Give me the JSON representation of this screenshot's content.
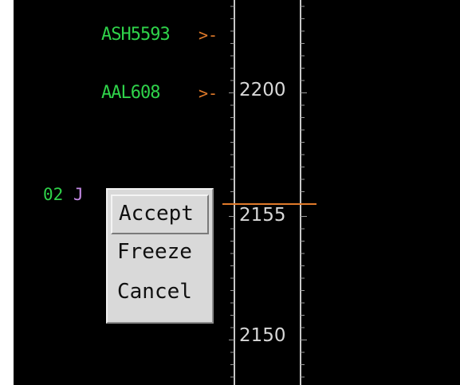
{
  "flights": [
    {
      "callsign": "ASH5593",
      "leader": ">-",
      "color": "#2fd24a"
    },
    {
      "callsign": "AAL608",
      "leader": ">-",
      "color": "#2fd24a"
    }
  ],
  "partial_flight": {
    "prefix": "02",
    "text": "J",
    "prefix_color": "#2fd24a",
    "text_color": "#c58ae6"
  },
  "timeline": {
    "labels": [
      "2200",
      "2155",
      "2150"
    ],
    "current_marker_color": "#e07a2a"
  },
  "popup_menu": {
    "items": [
      {
        "label": "Accept"
      },
      {
        "label": "Freeze"
      },
      {
        "label": "Cancel"
      }
    ]
  }
}
